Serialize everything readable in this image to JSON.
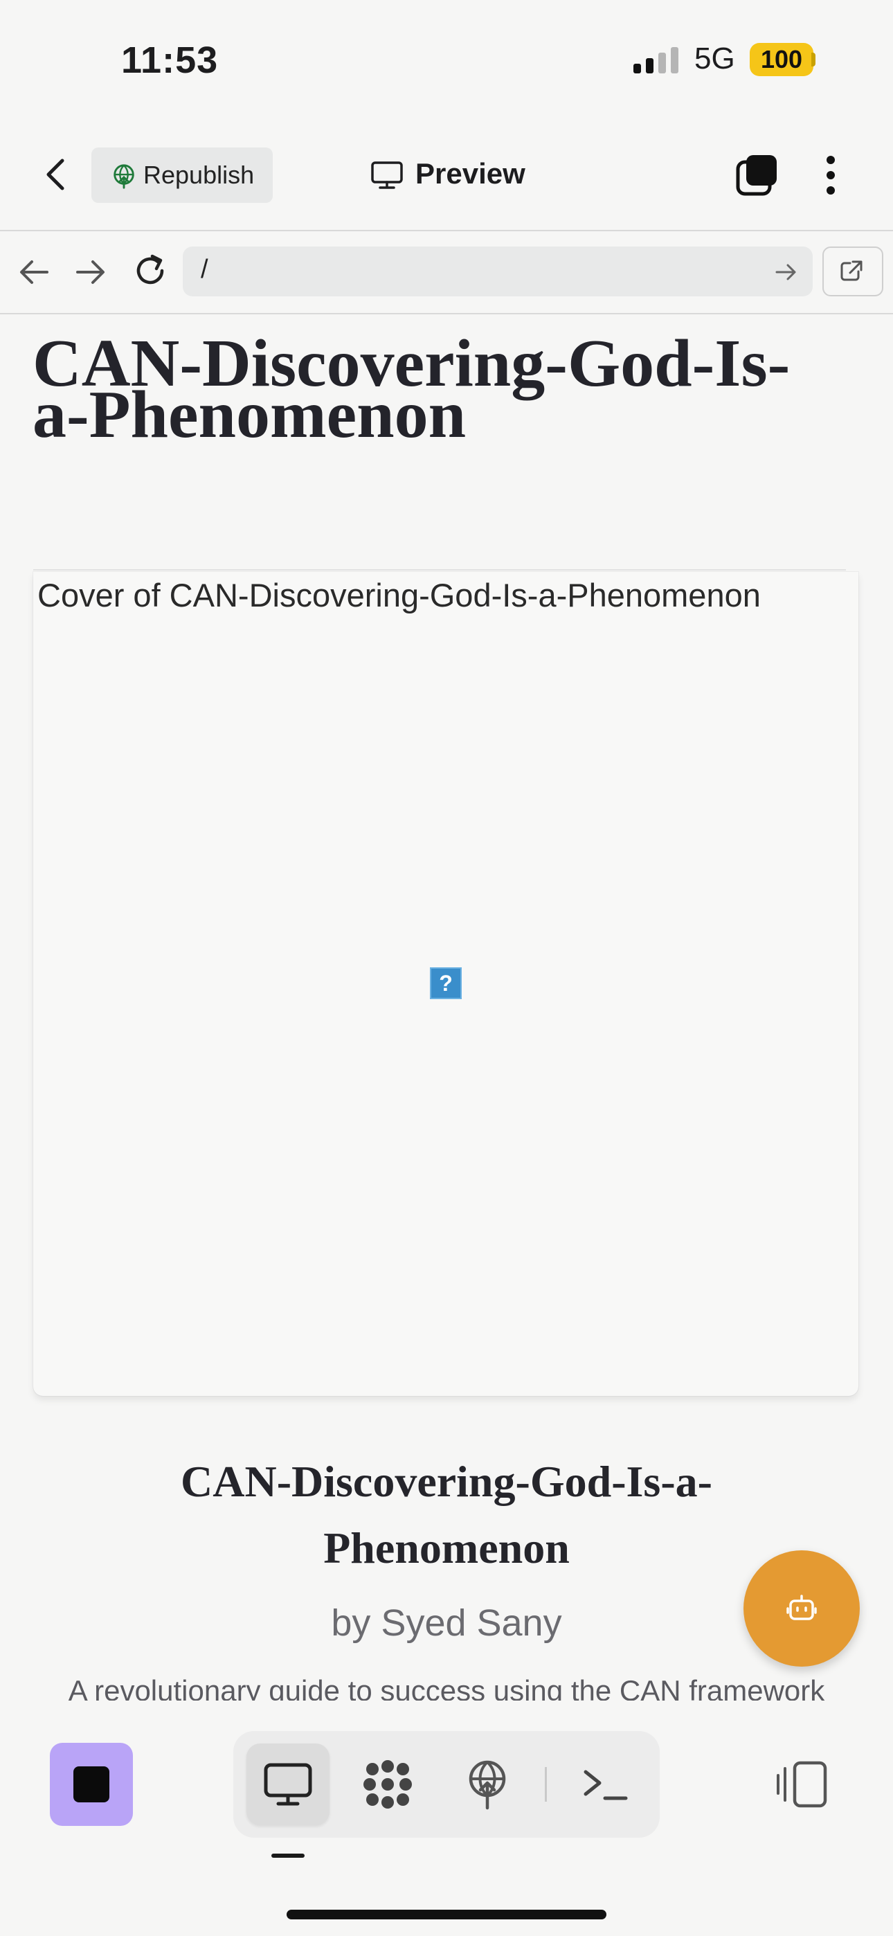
{
  "status_bar": {
    "time": "11:53",
    "network": "5G",
    "battery": "100"
  },
  "toolbar": {
    "republish_label": "Republish",
    "preview_label": "Preview"
  },
  "browser": {
    "url": "/"
  },
  "page": {
    "title_line1": "CAN-Discovering-God-Is-",
    "title_line2": "a-Phenomenon",
    "cover_alt": "Cover of CAN-Discovering-God-Is-a-Phenomenon",
    "broken_image_glyph": "?",
    "book_title_line1": "CAN-Discovering-God-Is-a-",
    "book_title_line2": "Phenomenon",
    "byline": "by Syed Sany",
    "description": "A revolutionary guide to success using the CAN framework"
  },
  "colors": {
    "fab": "#e49a32",
    "stop_button": "#b9a4f7",
    "battery": "#f5c518",
    "republish_icon": "#1f7a3a"
  },
  "icons": {
    "toolbar": [
      "chevron-left-icon",
      "globe-upload-icon",
      "monitor-icon",
      "tabs-icon",
      "more-vertical-icon"
    ],
    "browser": [
      "arrow-left-icon",
      "arrow-right-icon",
      "reload-icon",
      "arrow-right-icon",
      "external-link-icon"
    ],
    "bottom": [
      "stop-icon",
      "monitor-icon",
      "apps-icon",
      "globe-upload-icon",
      "terminal-icon",
      "panel-icon"
    ],
    "fab": "robot-icon"
  }
}
